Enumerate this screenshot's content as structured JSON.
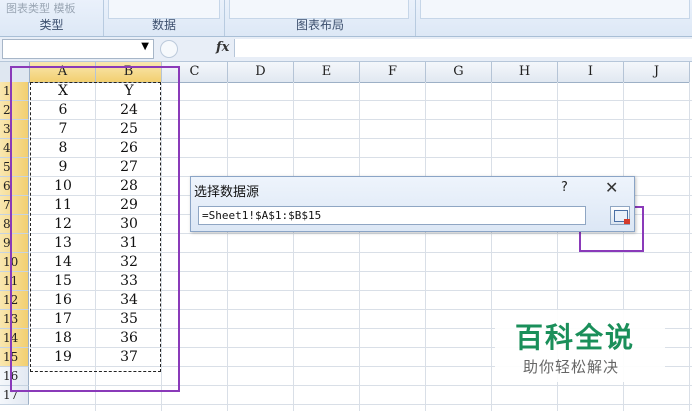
{
  "ribbon": {
    "group_chart_type_items": "图表类型 模板",
    "group_chart_type_label": "类型",
    "group_data_label": "数据",
    "group_layout_label": "图表布局"
  },
  "formula_bar": {
    "name_box": "",
    "fx_label": "fx",
    "formula": ""
  },
  "grid": {
    "columns": [
      "A",
      "B",
      "C",
      "D",
      "E",
      "F",
      "G",
      "H",
      "I",
      "J"
    ],
    "rows": [
      "1",
      "2",
      "3",
      "4",
      "5",
      "6",
      "7",
      "8",
      "9",
      "10",
      "11",
      "12",
      "13",
      "14",
      "15",
      "16",
      "17"
    ],
    "data": [
      [
        "X",
        "Y"
      ],
      [
        "6",
        "24"
      ],
      [
        "7",
        "25"
      ],
      [
        "8",
        "26"
      ],
      [
        "9",
        "27"
      ],
      [
        "10",
        "28"
      ],
      [
        "11",
        "29"
      ],
      [
        "12",
        "30"
      ],
      [
        "13",
        "31"
      ],
      [
        "14",
        "32"
      ],
      [
        "15",
        "33"
      ],
      [
        "16",
        "34"
      ],
      [
        "17",
        "35"
      ],
      [
        "18",
        "36"
      ],
      [
        "19",
        "37"
      ]
    ]
  },
  "dialog": {
    "title": "选择数据源",
    "help": "?",
    "close": "✕",
    "range_value": "=Sheet1!$A$1:$B$15"
  },
  "watermark": {
    "brand": "百科全说",
    "tagline": "助你轻松解决"
  },
  "colors": {
    "highlight": "#8a3ab9",
    "header_selected": "#f2cf70",
    "brand_green": "#1a8f5a"
  }
}
